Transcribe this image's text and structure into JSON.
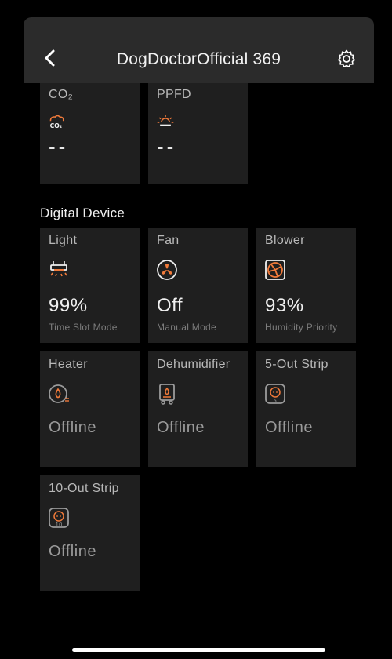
{
  "header": {
    "title": "DogDoctorOfficial 369"
  },
  "sensors": [
    {
      "label": "CO₂",
      "value": "--",
      "icon": "co2-icon"
    },
    {
      "label": "PPFD",
      "value": "--",
      "icon": "ppfd-icon"
    }
  ],
  "digital_section": {
    "title": "Digital Device"
  },
  "devices": [
    {
      "label": "Light",
      "value": "99%",
      "mode": "Time Slot Mode",
      "icon": "light-icon"
    },
    {
      "label": "Fan",
      "value": "Off",
      "mode": "Manual Mode",
      "icon": "fan-icon"
    },
    {
      "label": "Blower",
      "value": "93%",
      "mode": "Humidity Priority",
      "icon": "blower-icon"
    },
    {
      "label": "Heater",
      "value": "Offline",
      "icon": "heater-icon"
    },
    {
      "label": "Dehumidifier",
      "value": "Offline",
      "icon": "dehumidifier-icon"
    },
    {
      "label": "5-Out Strip",
      "value": "Offline",
      "icon": "power-strip-5-icon"
    },
    {
      "label": "10-Out Strip",
      "value": "Offline",
      "icon": "power-strip-10-icon"
    }
  ],
  "colors": {
    "accent": "#f07a3a",
    "card_bg": "#1f1f1f",
    "header_bg": "#2b2b2b",
    "offline_text": "#9a9a9a"
  }
}
